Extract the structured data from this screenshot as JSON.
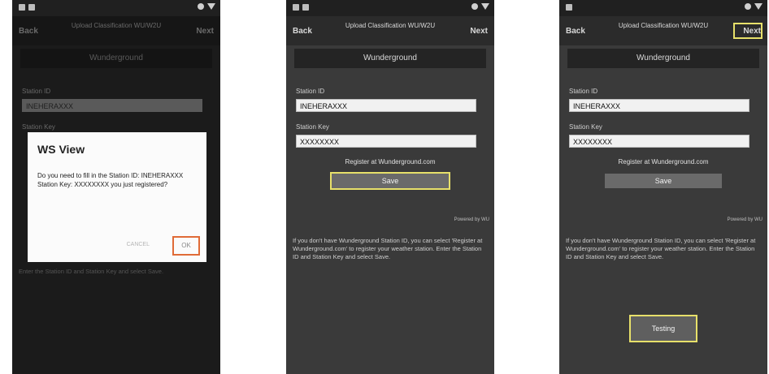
{
  "screens": [
    {
      "header": {
        "back": "Back",
        "title": "Upload Classification WU/W2U",
        "next": "Next"
      },
      "section": "Wunderground",
      "station_id_label": "Station ID",
      "station_id_value": "INEHERAXXX",
      "station_key_label": "Station Key",
      "help": "Enter the Station ID and Station Key and select Save.",
      "dialog": {
        "title": "WS View",
        "message": "Do you need to fill in the Station ID: INEHERAXXX Station Key: XXXXXXXX you just registered?",
        "cancel": "CANCEL",
        "ok": "OK"
      }
    },
    {
      "header": {
        "back": "Back",
        "title": "Upload Classification WU/W2U",
        "next": "Next"
      },
      "section": "Wunderground",
      "station_id_label": "Station ID",
      "station_id_value": "INEHERAXXX",
      "station_key_label": "Station Key",
      "station_key_value": "XXXXXXXX",
      "register": "Register at Wunderground.com",
      "save": "Save",
      "powered": "Powered by WU",
      "help": "If you don't have Wunderground Station ID, you can select 'Register at Wunderground.com' to register your weather station. Enter the Station ID and Station Key and select Save."
    },
    {
      "header": {
        "back": "Back",
        "title": "Upload Classification WU/W2U",
        "next": "Next"
      },
      "section": "Wunderground",
      "station_id_label": "Station ID",
      "station_id_value": "INEHERAXXX",
      "station_key_label": "Station Key",
      "station_key_value": "XXXXXXXX",
      "register": "Register at Wunderground.com",
      "save": "Save",
      "powered": "Powered by WU",
      "help": "If you don't have Wunderground Station ID, you can select 'Register at Wunderground.com' to register your weather station. Enter the Station ID and Station Key and select Save.",
      "testing": "Testing"
    }
  ],
  "colors": {
    "highlight_yellow": "#e7e06a",
    "highlight_orange": "#e06b37"
  }
}
